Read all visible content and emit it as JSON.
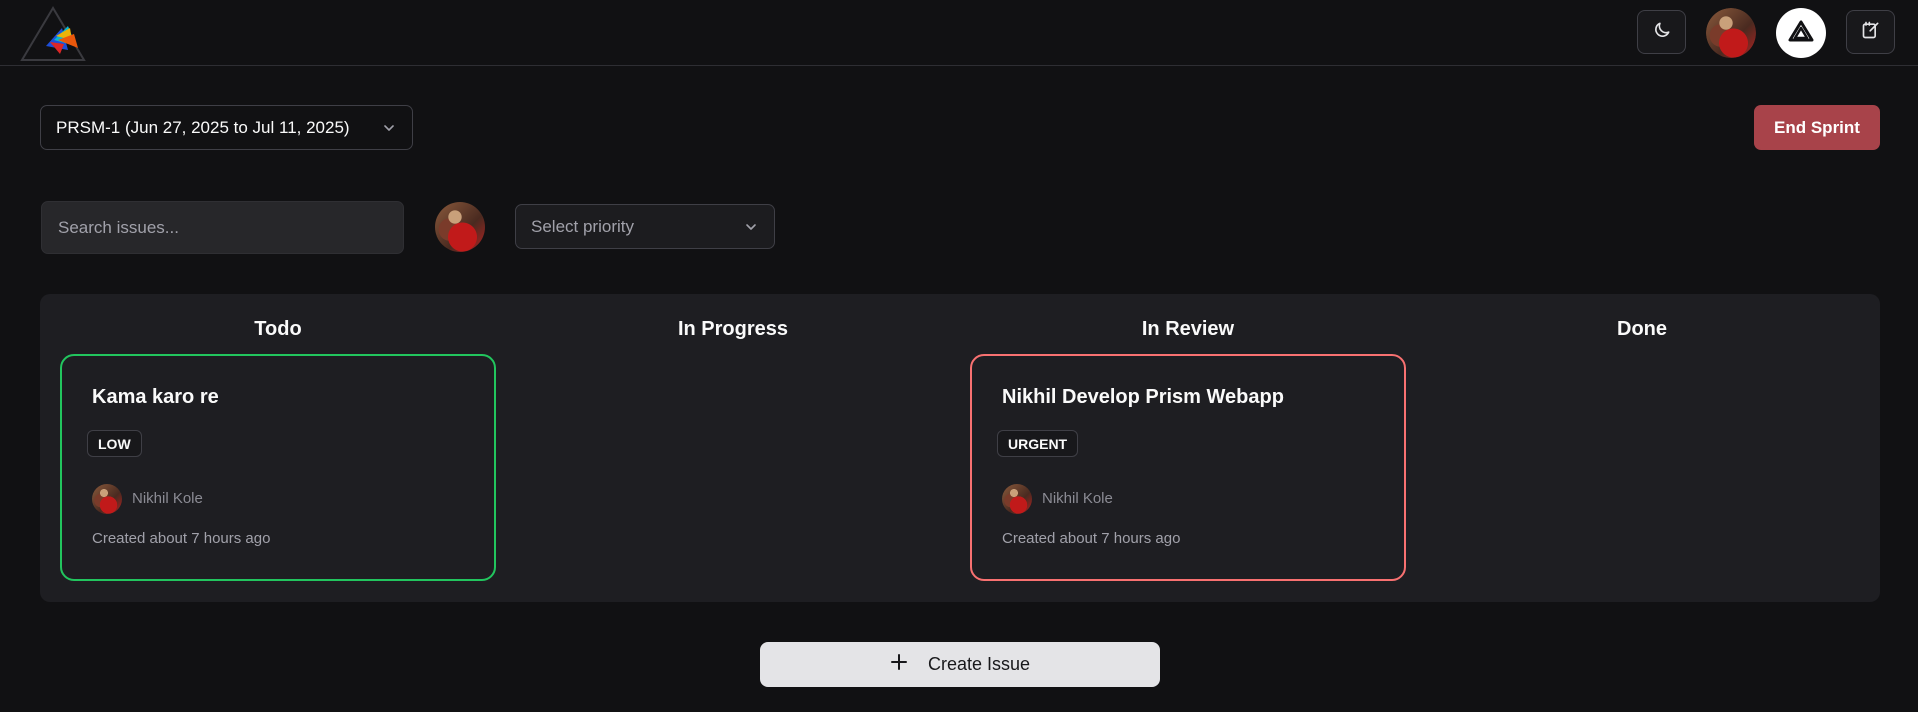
{
  "header": {
    "logo_icon": "prism-logo-icon",
    "theme_toggle_icon": "moon-icon",
    "brand_icon": "triangle-logo-icon",
    "edit_icon": "edit-note-icon"
  },
  "sprint": {
    "selected": "PRSM-1 (Jun 27, 2025 to Jul 11, 2025)",
    "end_label": "End Sprint"
  },
  "filters": {
    "search_placeholder": "Search issues...",
    "priority_placeholder": "Select priority"
  },
  "board": {
    "columns": [
      {
        "title": "Todo"
      },
      {
        "title": "In Progress"
      },
      {
        "title": "In Review"
      },
      {
        "title": "Done"
      }
    ],
    "cards": [
      {
        "title": "Kama karo re",
        "priority": "LOW",
        "assignee": "Nikhil Kole",
        "created": "Created about 7 hours ago"
      },
      {
        "title": "Nikhil Develop Prism Webapp",
        "priority": "URGENT",
        "assignee": "Nikhil Kole",
        "created": "Created about 7 hours ago"
      }
    ]
  },
  "actions": {
    "create_label": "Create Issue"
  },
  "colors": {
    "low_border": "#22c55e",
    "urgent_border": "#f87171",
    "end_sprint_bg": "#a8434a"
  }
}
